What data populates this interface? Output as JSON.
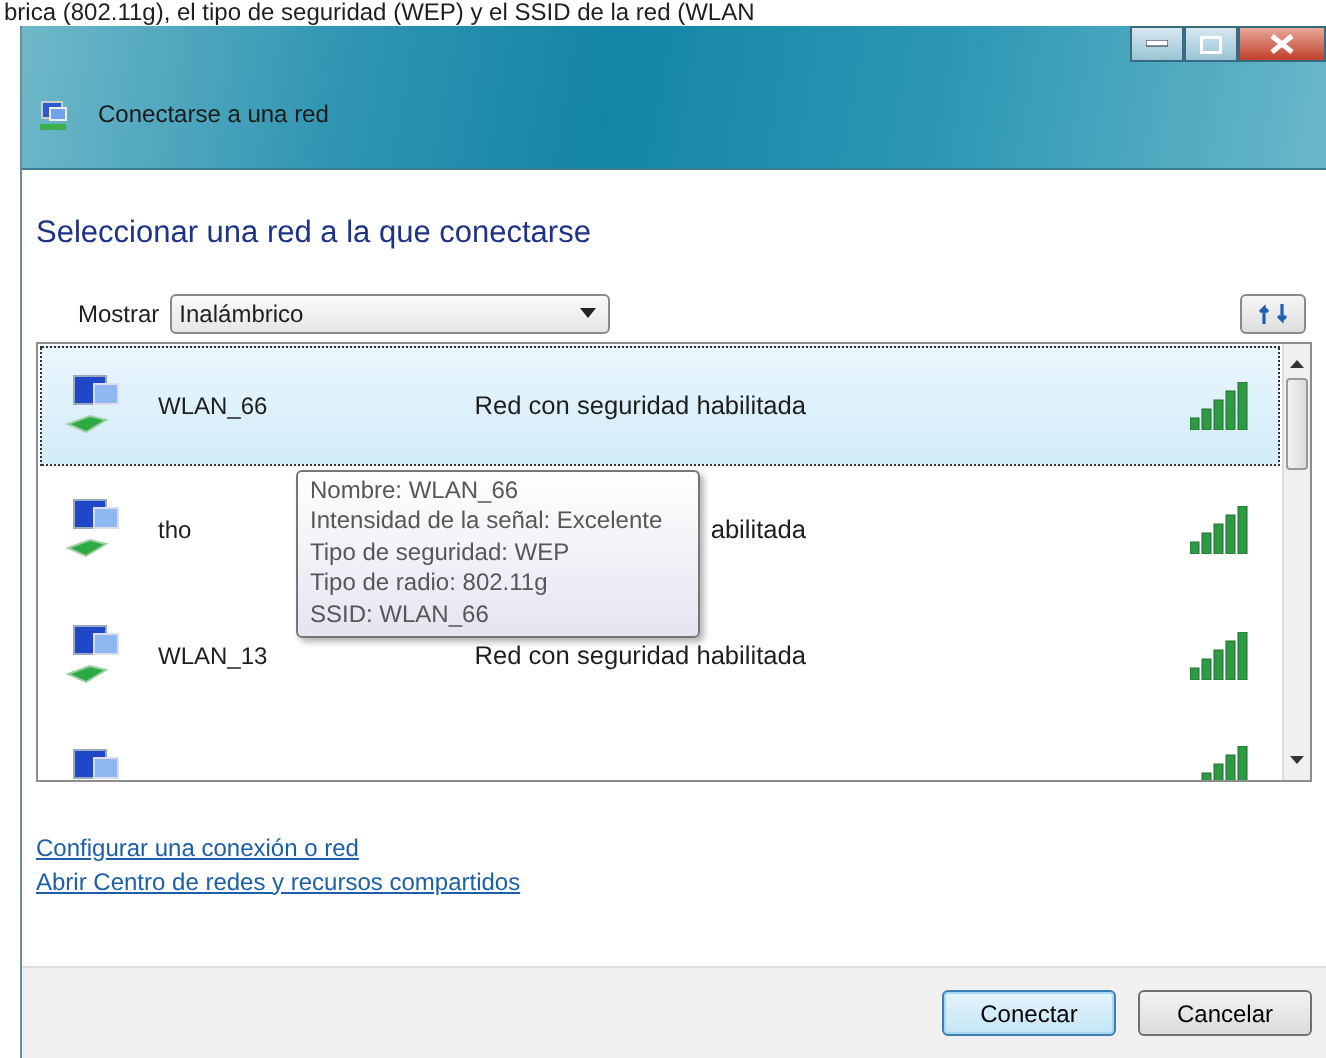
{
  "caption": "brica (802.11g), el tipo de seguridad (WEP) y el SSID de la red (WLAN",
  "window": {
    "title": "Conectarse a una red"
  },
  "heading": "Seleccionar una red a la que conectarse",
  "filter": {
    "label": "Mostrar",
    "value": "Inalámbrico"
  },
  "networks": [
    {
      "name": "WLAN_66",
      "status": "Red con seguridad habilitada",
      "selected": true
    },
    {
      "name": "tho",
      "status": "abilitada",
      "selected": false
    },
    {
      "name": "WLAN_13",
      "status": "Red con seguridad habilitada",
      "selected": false
    },
    {
      "kind": "partial",
      "selected": false
    }
  ],
  "tooltip": [
    "Nombre: WLAN_66",
    "Intensidad de la señal: Excelente",
    "Tipo de seguridad: WEP",
    "Tipo de radio: 802.11g",
    "SSID: WLAN_66"
  ],
  "links": [
    "Configurar una conexión o red",
    "Abrir Centro de redes y recursos compartidos"
  ],
  "buttons": [
    {
      "label": "Conectar",
      "default": true
    },
    {
      "label": "Cancelar",
      "default": false
    }
  ]
}
